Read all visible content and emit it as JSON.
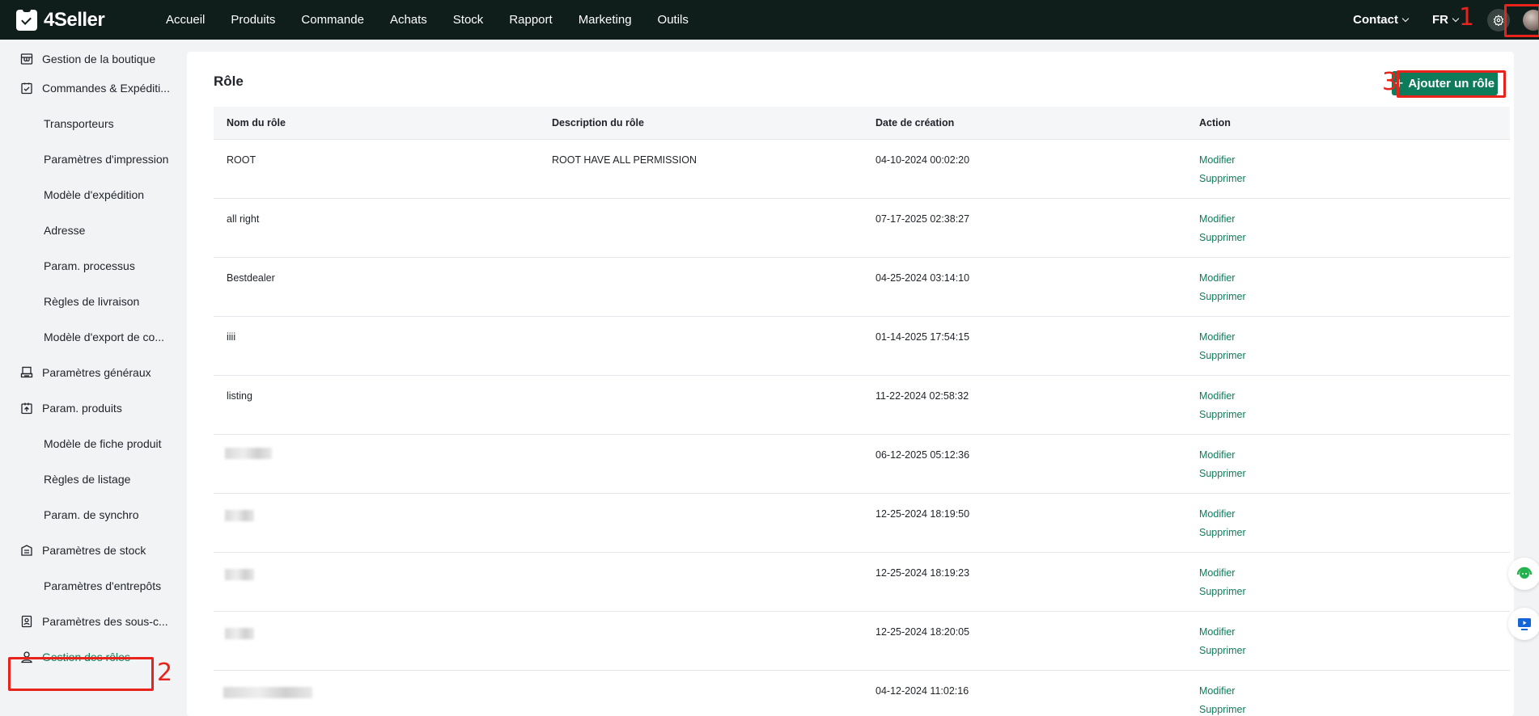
{
  "app": {
    "name": "4Seller"
  },
  "nav": [
    "Accueil",
    "Produits",
    "Commande",
    "Achats",
    "Stock",
    "Rapport",
    "Marketing",
    "Outils"
  ],
  "header_right": {
    "contact": "Contact",
    "language": "FR"
  },
  "sidebar": {
    "items": [
      {
        "label": "Gestion de la boutique",
        "icon": "store-icon"
      },
      {
        "label": "Commandes & Expéditi...",
        "icon": "orders-icon"
      },
      {
        "label": "Transporteurs"
      },
      {
        "label": "Paramètres d'impression"
      },
      {
        "label": "Modèle d'expédition"
      },
      {
        "label": "Adresse"
      },
      {
        "label": "Param. processus"
      },
      {
        "label": "Règles de livraison"
      },
      {
        "label": "Modèle d'export de co..."
      },
      {
        "label": "Paramètres généraux",
        "icon": "printer-icon"
      },
      {
        "label": "Param. produits",
        "icon": "product-upload-icon"
      },
      {
        "label": "Modèle de fiche produit"
      },
      {
        "label": "Règles de listage"
      },
      {
        "label": "Param. de synchro"
      },
      {
        "label": "Paramètres de stock",
        "icon": "stock-icon"
      },
      {
        "label": "Paramètres d'entrepôts"
      },
      {
        "label": "Paramètres des sous-c...",
        "icon": "badge-icon"
      },
      {
        "label": "Gestion des rôles",
        "icon": "user-icon"
      }
    ]
  },
  "page": {
    "title": "Rôle",
    "add_button": "Ajouter un rôle",
    "columns": [
      "Nom du rôle",
      "Description du rôle",
      "Date de création",
      "Action"
    ],
    "action_edit": "Modifier",
    "action_delete": "Supprimer",
    "rows": [
      {
        "name": "ROOT",
        "description": "ROOT HAVE ALL PERMISSION",
        "created": "04-10-2024 00:02:20"
      },
      {
        "name": "all right",
        "description": "",
        "created": "07-17-2025 02:38:27"
      },
      {
        "name": "Bestdealer",
        "description": "",
        "created": "04-25-2024 03:14:10"
      },
      {
        "name": "iiii",
        "description": "",
        "created": "01-14-2025 17:54:15"
      },
      {
        "name": "listing",
        "description": "",
        "created": "11-22-2024 02:58:32"
      },
      {
        "name": "",
        "description": "",
        "created": "06-12-2025 05:12:36",
        "redacted": true
      },
      {
        "name": "",
        "description": "",
        "created": "12-25-2024 18:19:50",
        "redacted": true
      },
      {
        "name": "",
        "description": "",
        "created": "12-25-2024 18:19:23",
        "redacted": true
      },
      {
        "name": "",
        "description": "",
        "created": "12-25-2024 18:20:05",
        "redacted": true
      },
      {
        "name": "",
        "description": "",
        "created": "04-12-2024 11:02:16",
        "redacted": true
      }
    ]
  },
  "annotations": [
    "1",
    "2",
    "3"
  ],
  "colors": {
    "topbar": "#0f1d1b",
    "accent": "#0e7c5b",
    "annotation": "#e8231c"
  }
}
